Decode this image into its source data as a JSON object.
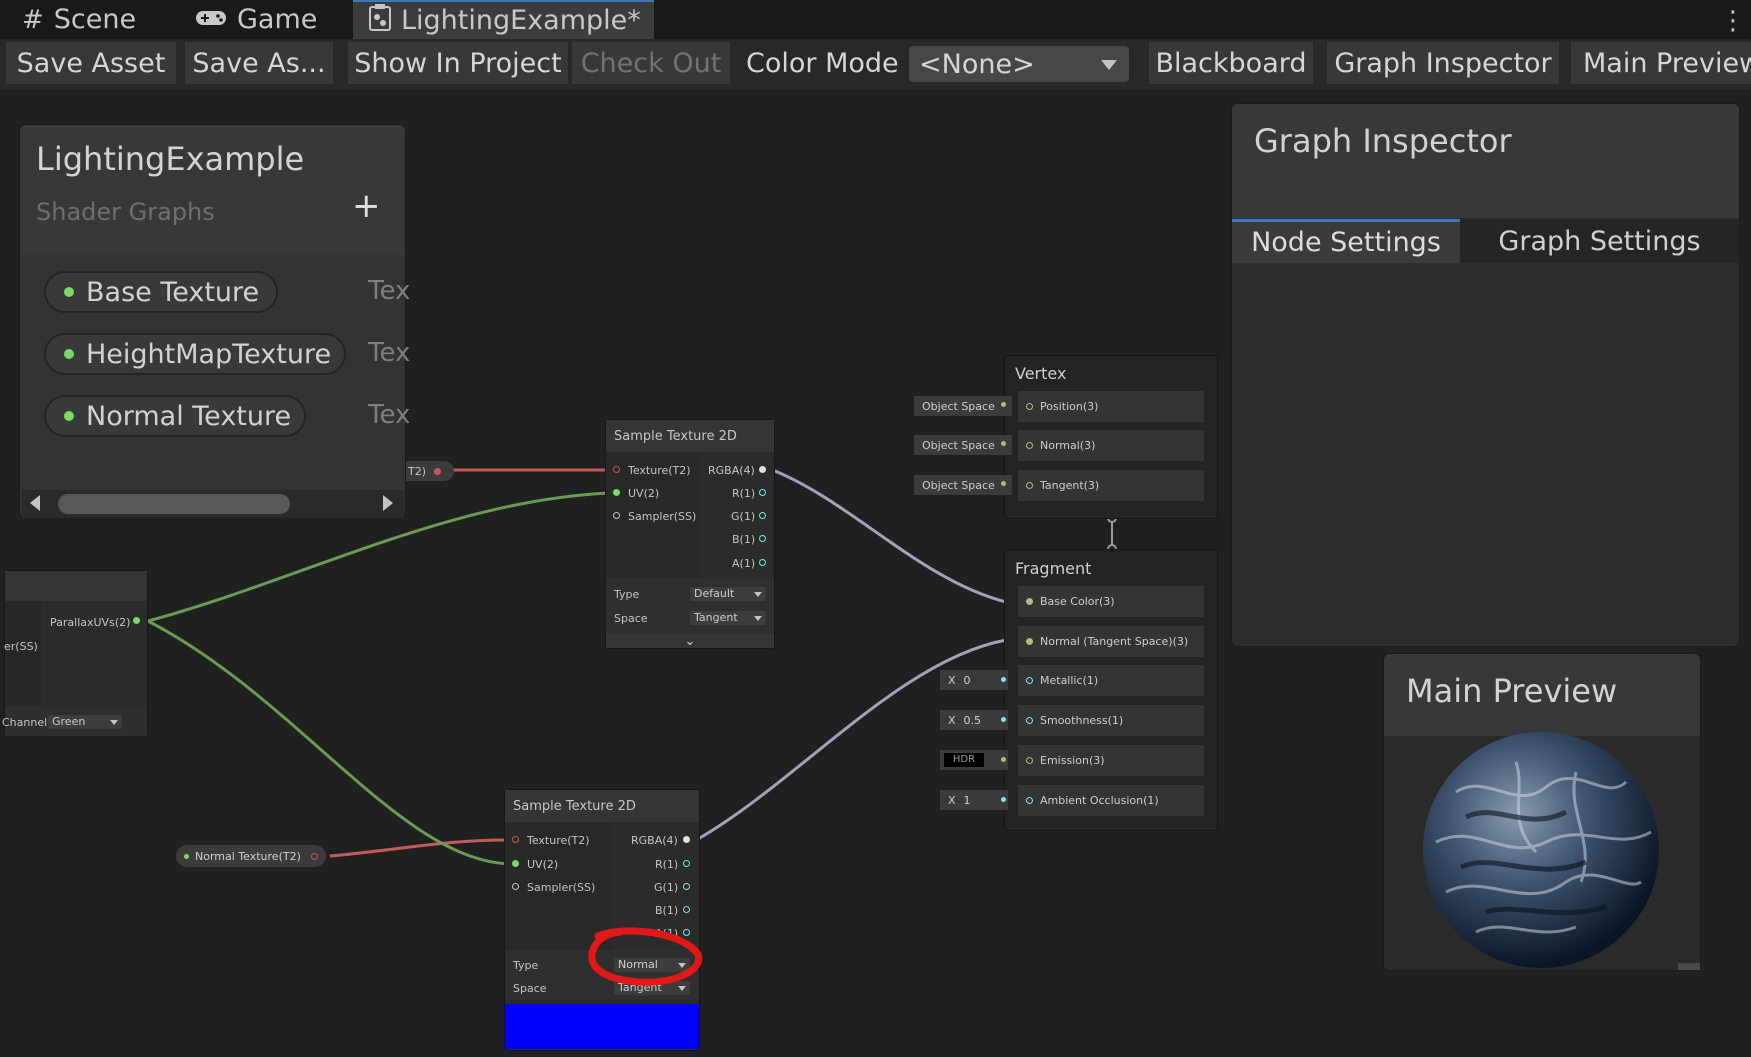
{
  "tabs": [
    {
      "label": "Scene",
      "icon": "grid-icon"
    },
    {
      "label": "Game",
      "icon": "gamepad-icon"
    },
    {
      "label": "LightingExample*",
      "icon": "shader-graph-icon"
    }
  ],
  "toolbar": {
    "save_asset": "Save Asset",
    "save_as": "Save As...",
    "show_in_project": "Show In Project",
    "check_out": "Check Out",
    "color_mode_label": "Color Mode",
    "color_mode_value": "<None>",
    "blackboard": "Blackboard",
    "graph_inspector": "Graph Inspector",
    "main_preview": "Main Preview"
  },
  "blackboard": {
    "title": "LightingExample",
    "subtitle": "Shader Graphs",
    "add_symbol": "+",
    "properties": [
      {
        "name": "Base Texture",
        "type": "Tex"
      },
      {
        "name": "HeightMapTexture",
        "type": "Tex"
      },
      {
        "name": "Normal Texture",
        "type": "Tex"
      }
    ],
    "partial_port": "T2)"
  },
  "parallax_node": {
    "output": "ParallaxUVs(2)",
    "sampler_partial": "er(SS)",
    "channel_label": "Channel",
    "channel_value": "Green"
  },
  "sample_top": {
    "title": "Sample Texture 2D",
    "inputs": [
      "Texture(T2)",
      "UV(2)",
      "Sampler(SS)"
    ],
    "outputs": [
      "RGBA(4)",
      "R(1)",
      "G(1)",
      "B(1)",
      "A(1)"
    ],
    "type_label": "Type",
    "type_value": "Default",
    "space_label": "Space",
    "space_value": "Tangent",
    "expand_symbol": "⌄"
  },
  "sample_bottom": {
    "title": "Sample Texture 2D",
    "inputs": [
      "Texture(T2)",
      "UV(2)",
      "Sampler(SS)"
    ],
    "outputs": [
      "RGBA(4)",
      "R(1)",
      "G(1)",
      "B(1)",
      "A(1)"
    ],
    "type_label": "Type",
    "type_value": "Normal",
    "space_label": "Space",
    "space_value": "Tangent"
  },
  "normal_texture_chip": "Normal Texture(T2)",
  "vertex": {
    "title": "Vertex",
    "rows": [
      {
        "chip": "Object Space",
        "label": "Position(3)"
      },
      {
        "chip": "Object Space",
        "label": "Normal(3)"
      },
      {
        "chip": "Object Space",
        "label": "Tangent(3)"
      }
    ]
  },
  "fragment": {
    "title": "Fragment",
    "rows": [
      {
        "chip": "",
        "label": "Base Color(3)"
      },
      {
        "chip": "",
        "label": "Normal (Tangent Space)(3)"
      },
      {
        "chip_prefix": "X",
        "chip": "0",
        "label": "Metallic(1)"
      },
      {
        "chip_prefix": "X",
        "chip": "0.5",
        "label": "Smoothness(1)"
      },
      {
        "chip": "HDR",
        "label": "Emission(3)"
      },
      {
        "chip_prefix": "X",
        "chip": "1",
        "label": "Ambient Occlusion(1)"
      }
    ]
  },
  "graph_inspector": {
    "title": "Graph Inspector",
    "tab_node": "Node Settings",
    "tab_graph": "Graph Settings"
  },
  "main_preview": {
    "title": "Main Preview"
  },
  "colors": {
    "texture_wire": "#c25b5b",
    "uv_wire": "#6a9a55",
    "vector4_wire": "#a79fb5",
    "vector3_wire": "#b8b87b",
    "float_wire": "#84e4e7",
    "accent_tab": "#3a79bb",
    "annotation": "#e01818",
    "preview_swatch": "#0000ff"
  }
}
